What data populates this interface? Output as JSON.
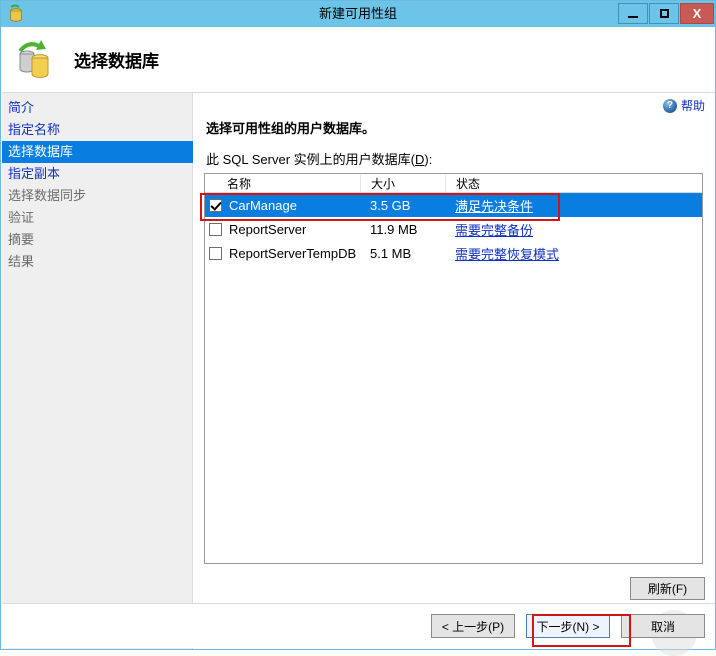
{
  "window": {
    "title": "新建可用性组",
    "icon": "database-icon",
    "controls": {
      "minimize": "minimize-icon",
      "maximize": "maximize-icon",
      "close": "X"
    }
  },
  "header": {
    "title": "选择数据库",
    "icon": "database-sync-icon"
  },
  "sidebar": {
    "items": [
      {
        "label": "简介",
        "state": "link"
      },
      {
        "label": "指定名称",
        "state": "link"
      },
      {
        "label": "选择数据库",
        "state": "selected"
      },
      {
        "label": "指定副本",
        "state": "link"
      },
      {
        "label": "选择数据同步",
        "state": "disabled"
      },
      {
        "label": "验证",
        "state": "disabled"
      },
      {
        "label": "摘要",
        "state": "disabled"
      },
      {
        "label": "结果",
        "state": "disabled"
      }
    ]
  },
  "content": {
    "help_label": "帮助",
    "help_icon": "help-icon",
    "help_glyph": "?",
    "instruction": "选择可用性组的用户数据库。",
    "list_label_pre": "此 SQL Server 实例上的用户数据库(",
    "list_label_accel": "D",
    "list_label_post": "):",
    "columns": [
      "名称",
      "大小",
      "状态"
    ],
    "rows": [
      {
        "checked": true,
        "name": "CarManage",
        "size": "3.5 GB",
        "state": "满足先决条件",
        "selected": true
      },
      {
        "checked": false,
        "name": "ReportServer",
        "size": "11.9 MB",
        "state": "需要完整备份",
        "selected": false
      },
      {
        "checked": false,
        "name": "ReportServerTempDB",
        "size": "5.1 MB",
        "state": "需要完整恢复模式",
        "selected": false
      }
    ],
    "refresh_label": "刷新(F)"
  },
  "footer": {
    "back_label": "< 上一步(P)",
    "next_label": "下一步(N) >",
    "cancel_label": "取消"
  },
  "colors": {
    "titlebar": "#6CC4E8",
    "close_button": "#C75B53",
    "selection": "#0A7EE0",
    "link": "#1030C0",
    "annotation": "#D01616",
    "sidebar": "#EFEFEF"
  }
}
